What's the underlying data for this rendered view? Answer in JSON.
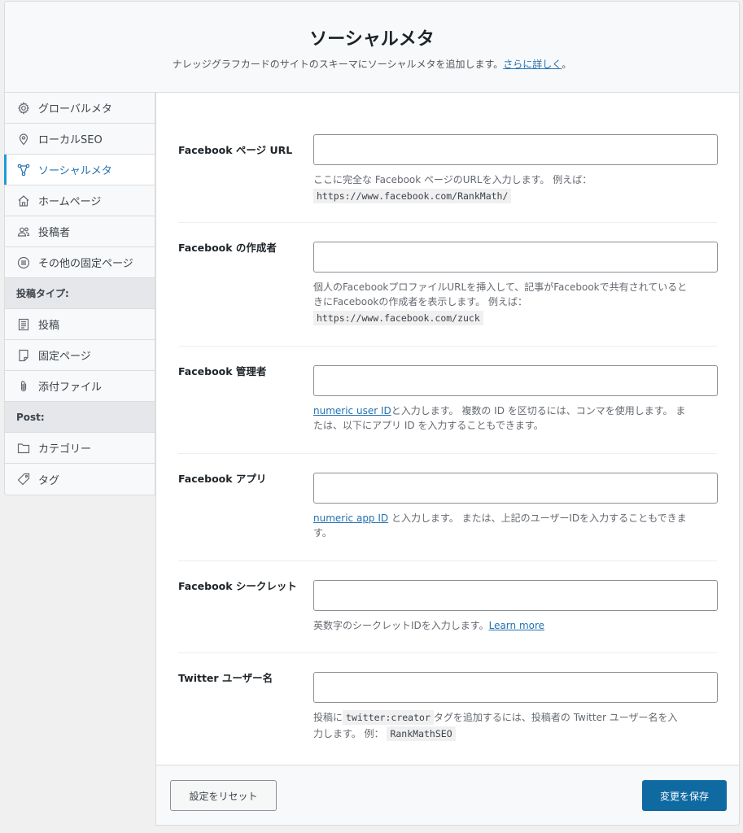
{
  "header": {
    "title": "ソーシャルメタ",
    "subtitle": "ナレッジグラフカードのサイトのスキーマにソーシャルメタを追加します。",
    "link": "さらに詳しく",
    "link_suffix": "。"
  },
  "sidebar": {
    "items": [
      {
        "label": "グローバルメタ",
        "icon": "gear-icon"
      },
      {
        "label": "ローカルSEO",
        "icon": "location-pin-icon"
      },
      {
        "label": "ソーシャルメタ",
        "icon": "share-nodes-icon",
        "active": true
      },
      {
        "label": "ホームページ",
        "icon": "home-icon"
      },
      {
        "label": "投稿者",
        "icon": "users-icon"
      },
      {
        "label": "その他の固定ページ",
        "icon": "list-circle-icon"
      }
    ],
    "post_types_heading": "投稿タイプ:",
    "post_types": [
      {
        "label": "投稿",
        "icon": "post-icon"
      },
      {
        "label": "固定ページ",
        "icon": "page-icon"
      },
      {
        "label": "添付ファイル",
        "icon": "paperclip-icon"
      }
    ],
    "post_heading": "Post:",
    "post_items": [
      {
        "label": "カテゴリー",
        "icon": "folder-icon"
      },
      {
        "label": "タグ",
        "icon": "tag-icon"
      }
    ]
  },
  "fields": {
    "fb_page": {
      "label": "Facebook ページ URL",
      "value": "",
      "desc": "ここに完全な Facebook ページのURLを入力します。 例えば：",
      "code": "https://www.facebook.com/RankMath/"
    },
    "fb_author": {
      "label": "Facebook の作成者",
      "value": "",
      "desc1": "個人のFacebookプロファイルURLを挿入して、記事がFacebookで共有されていると",
      "desc2": "きにFacebookの作成者を表示します。 例えば：",
      "code": "https://www.facebook.com/zuck"
    },
    "fb_admin": {
      "label": "Facebook 管理者",
      "value": "",
      "link": "numeric user ID",
      "desc1": "と入力します。 複数の ID を区切るには、コンマを使用します。 ま",
      "desc2": "たは、以下にアプリ ID を入力することもできます。"
    },
    "fb_app": {
      "label": "Facebook アプリ",
      "value": "",
      "link": "numeric app ID",
      "desc1": " と入力します。 または、上記のユーザーIDを入力することもできま",
      "desc2": "す。"
    },
    "fb_secret": {
      "label": "Facebook シークレット",
      "value": "",
      "desc": "英数字のシークレットIDを入力します。",
      "link": "Learn more"
    },
    "twitter": {
      "label": "Twitter ユーザー名",
      "value": "",
      "desc_pre": "投稿に",
      "code1": "twitter:creator",
      "desc_mid": "タグを追加するには、投稿者の Twitter ユーザー名を入",
      "desc_line2": "力します。 例：",
      "code2": "RankMathSEO"
    }
  },
  "footer": {
    "reset_label": "設定をリセット",
    "save_label": "変更を保存"
  },
  "colors": {
    "accent": "#2271b1",
    "save_button": "#0f6aa2",
    "active_bar": "#1d9bd7"
  }
}
